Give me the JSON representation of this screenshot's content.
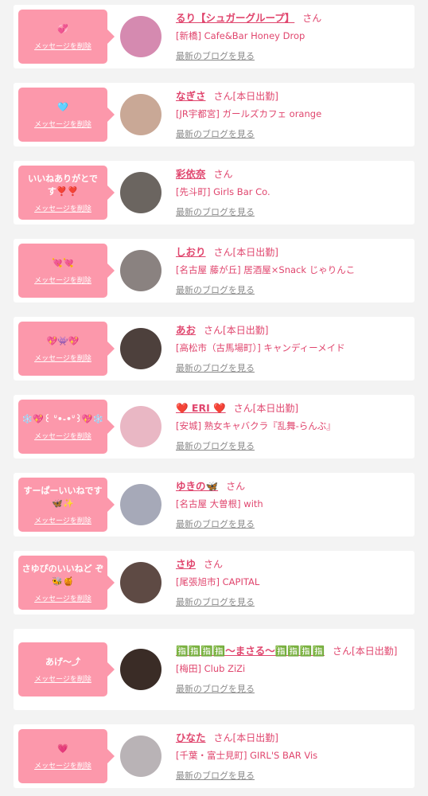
{
  "delete_label": "メッセージを削除",
  "blog_label": "最新のブログを見る",
  "san_label": "さん",
  "items": [
    {
      "message": "💞",
      "name": "るり【シュガーグループ】",
      "status": "",
      "shop": "[新橋] Cafe&Bar Honey Drop",
      "avatar_color": "#d58ab0"
    },
    {
      "message": "🩵",
      "name": "なぎさ",
      "status": "[本日出勤]",
      "shop": "[JR宇都宮] ガールズカフェ orange",
      "avatar_color": "#c9a896"
    },
    {
      "message": "いいねありがとです❣️❣️",
      "name": "彩依奈",
      "status": "",
      "shop": "[先斗町] Girls Bar Co.",
      "avatar_color": "#6b6560"
    },
    {
      "message": "💘💘",
      "name": "しおり",
      "status": "[本日出勤]",
      "shop": "[名古屋 藤が丘] 居酒屋×Snack じゃりんこ",
      "avatar_color": "#8a8280"
    },
    {
      "message": "💖👾💖",
      "name": "あお",
      "status": "[本日出勤]",
      "shop": "[高松市（古馬場町）] キャンディーメイド",
      "avatar_color": "#4d403c"
    },
    {
      "message": "❄️💖꒰ ᐡ•֊•ᐡ꒱💖❄️",
      "name": "❤️ ERI ❤️",
      "status": "[本日出勤]",
      "shop": "[安城] 熟女キャバクラ『乱舞-らんぶ』",
      "avatar_color": "#e9b7c4"
    },
    {
      "message": "すーぱーいいねです🦋✨",
      "name": "ゆきの🦋",
      "status": "",
      "shop": "[名古屋 大曽根] with",
      "avatar_color": "#a6a9b8"
    },
    {
      "message": "さゆぴのいいねど ぞ🐝🍯",
      "name": "さゆ",
      "status": "",
      "shop": "[尾張旭市] CAPITAL",
      "avatar_color": "#5e4a44"
    },
    {
      "message": "あげ〜⤴︎",
      "name": "🈯🈯🈯🈯〜まさる〜🈯🈯🈯🈯",
      "status": "[本日出勤]",
      "shop": "[梅田] Club ZiZi",
      "avatar_color": "#3a2c26"
    },
    {
      "message": "💗",
      "name": "ひなた",
      "status": "[本日出勤]",
      "shop": "[千葉・富士見町] GIRL'S BAR Vis",
      "avatar_color": "#b9b3b6"
    }
  ]
}
